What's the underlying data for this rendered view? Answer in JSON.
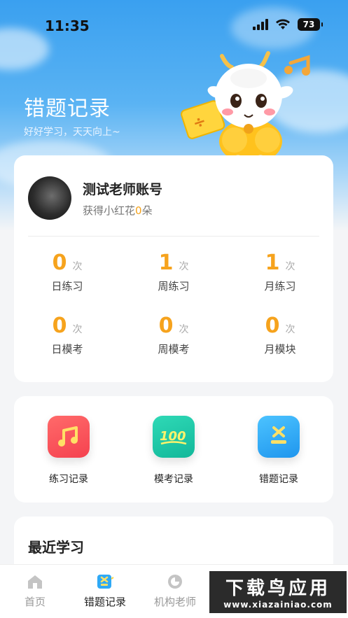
{
  "status_bar": {
    "time": "11:35",
    "battery": "73"
  },
  "header": {
    "title": "错题记录",
    "subtitle": "好好学习，天天向上~"
  },
  "profile": {
    "name": "测试老师账号",
    "flowers_prefix": "获得小红花",
    "flowers_count": "0",
    "flowers_suffix": "朵"
  },
  "stats": [
    {
      "value": "0",
      "unit": "次",
      "label": "日练习"
    },
    {
      "value": "1",
      "unit": "次",
      "label": "周练习"
    },
    {
      "value": "1",
      "unit": "次",
      "label": "月练习"
    },
    {
      "value": "0",
      "unit": "次",
      "label": "日模考"
    },
    {
      "value": "0",
      "unit": "次",
      "label": "周模考"
    },
    {
      "value": "0",
      "unit": "次",
      "label": "月模块"
    }
  ],
  "actions": [
    {
      "label": "练习记录",
      "icon": "music-note-icon",
      "color": "#f5424f"
    },
    {
      "label": "模考记录",
      "icon": "score-100-icon",
      "color": "#17c7a5"
    },
    {
      "label": "错题记录",
      "icon": "wrong-question-icon",
      "color": "#2fa9f5"
    }
  ],
  "recent": {
    "title": "最近学习"
  },
  "tabbar": [
    {
      "label": "首页",
      "icon": "home-icon",
      "active": false
    },
    {
      "label": "错题记录",
      "icon": "wrong-question-icon",
      "active": true
    },
    {
      "label": "机构老师",
      "icon": "teacher-icon",
      "active": false
    }
  ],
  "watermark": {
    "main": "下载鸟应用",
    "url": "www.xiazainiao.com"
  },
  "colors": {
    "accent": "#f6a31d",
    "primary": "#3aa0f0"
  }
}
